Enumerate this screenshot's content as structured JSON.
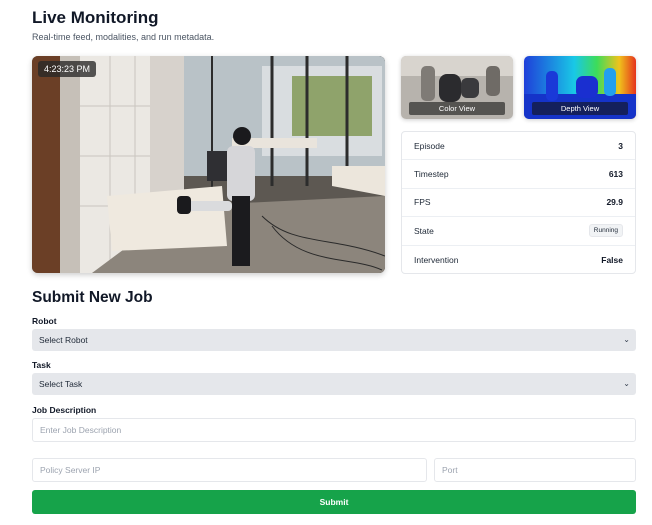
{
  "header": {
    "title": "Live Monitoring",
    "subtitle": "Real-time feed, modalities, and run metadata."
  },
  "feed": {
    "time": "4:23:23 PM"
  },
  "thumbnails": {
    "color_label": "Color View",
    "depth_label": "Depth View"
  },
  "metrics": [
    {
      "label": "Episode",
      "value": "3"
    },
    {
      "label": "Timestep",
      "value": "613"
    },
    {
      "label": "FPS",
      "value": "29.9"
    },
    {
      "label": "State",
      "value": "Running"
    },
    {
      "label": "Intervention",
      "value": "False"
    }
  ],
  "job_form": {
    "title": "Submit New Job",
    "robot_label": "Robot",
    "robot_value": "Select Robot",
    "task_label": "Task",
    "task_value": "Select Task",
    "description_label": "Job Description",
    "description_placeholder": "Enter Job Description",
    "policy_ip_placeholder": "Policy Server IP",
    "port_placeholder": "Port",
    "submit_label": "Submit"
  },
  "colors": {
    "submit": "#16a34a",
    "select_bg": "#e5e7eb"
  }
}
